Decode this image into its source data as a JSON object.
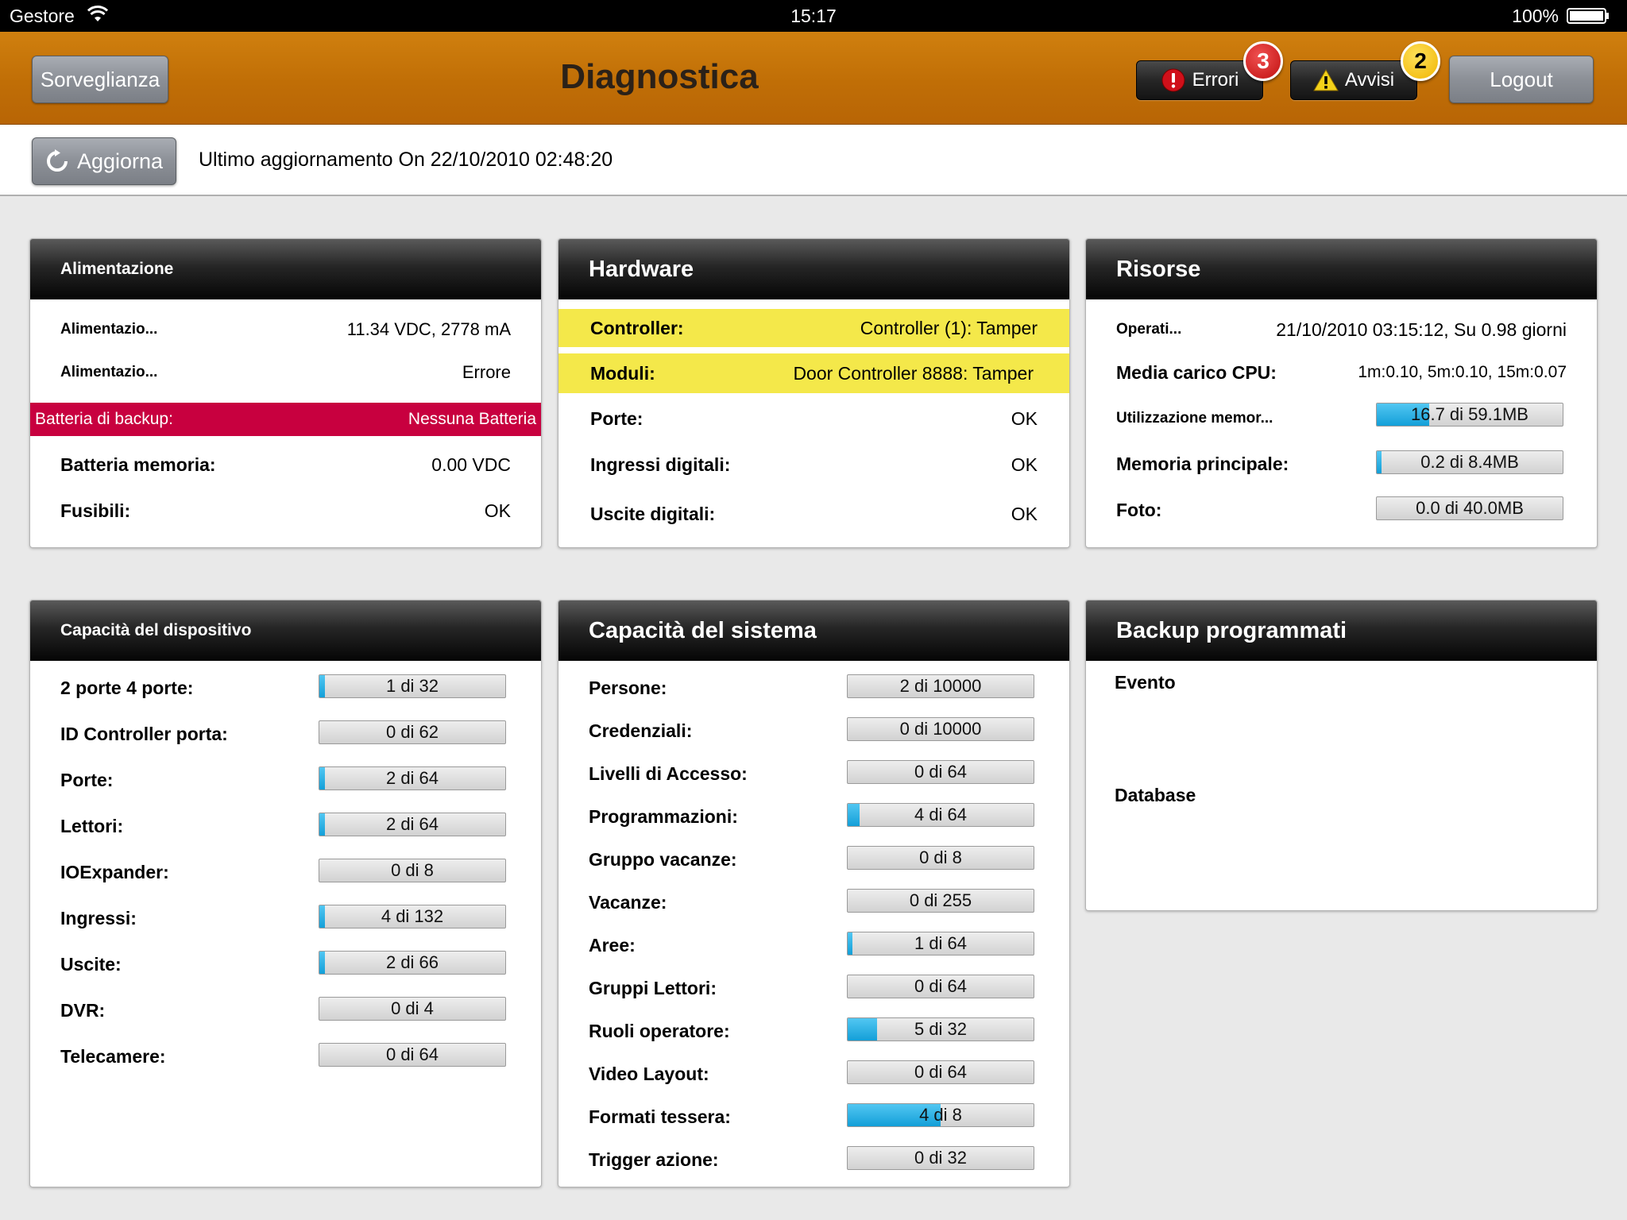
{
  "status_bar": {
    "carrier": "Gestore",
    "time": "15:17",
    "battery": "100%"
  },
  "nav": {
    "left_button": "Sorveglianza",
    "title": "Diagnostica",
    "errors": {
      "label": "Errori",
      "count": "3"
    },
    "warnings": {
      "label": "Avvisi",
      "count": "2"
    },
    "logout": "Logout"
  },
  "refresh": {
    "button": "Aggiorna",
    "last_update": "Ultimo aggiornamento On 22/10/2010 02:48:20"
  },
  "colors": {
    "nav_orange": "#c06e06",
    "error_red": "#c8003f",
    "warning_yellow": "#f4e84a",
    "progress_blue": "#1aa4dc"
  },
  "power": {
    "title": "Alimentazione",
    "rows": [
      {
        "label": "Alimentazio...",
        "value": "11.34 VDC, 2778 mA"
      },
      {
        "label": "Alimentazio...",
        "value": "Errore"
      },
      {
        "label": "Batteria di backup:",
        "value": "Nessuna Batteria"
      },
      {
        "label": "Batteria memoria:",
        "value": "0.00 VDC"
      },
      {
        "label": "Fusibili:",
        "value": "OK"
      }
    ]
  },
  "hardware": {
    "title": "Hardware",
    "rows": [
      {
        "label": "Controller:",
        "value": "Controller (1): Tamper"
      },
      {
        "label": "Moduli:",
        "value": "Door Controller 8888: Tamper"
      },
      {
        "label": "Porte:",
        "value": "OK"
      },
      {
        "label": "Ingressi digitali:",
        "value": "OK"
      },
      {
        "label": "Uscite digitali:",
        "value": "OK"
      }
    ]
  },
  "resources": {
    "title": "Risorse",
    "rows": [
      {
        "label": "Operati...",
        "value": "21/10/2010 03:15:12, Su 0.98 giorni"
      },
      {
        "label": "Media carico CPU:",
        "value": "1m:0.10, 5m:0.10, 15m:0.07"
      },
      {
        "label": "Utilizzazione memor...",
        "value": "16.7 di 59.1MB",
        "fill": 0.283
      },
      {
        "label": "Memoria principale:",
        "value": "0.2 di 8.4MB",
        "fill": 0.024
      },
      {
        "label": "Foto:",
        "value": "0.0 di 40.0MB",
        "fill": 0
      }
    ]
  },
  "device_capacity": {
    "title": "Capacità del dispositivo",
    "rows": [
      {
        "label": "2 porte 4 porte:",
        "value": "1 di 32",
        "fill": 0.031
      },
      {
        "label": "ID Controller porta:",
        "value": "0 di 62",
        "fill": 0
      },
      {
        "label": "Porte:",
        "value": "2 di 64",
        "fill": 0.031
      },
      {
        "label": "Lettori:",
        "value": "2 di 64",
        "fill": 0.031
      },
      {
        "label": "IOExpander:",
        "value": "0 di 8",
        "fill": 0
      },
      {
        "label": "Ingressi:",
        "value": "4 di 132",
        "fill": 0.03
      },
      {
        "label": "Uscite:",
        "value": "2 di 66",
        "fill": 0.03
      },
      {
        "label": "DVR:",
        "value": "0 di 4",
        "fill": 0
      },
      {
        "label": "Telecamere:",
        "value": "0 di 64",
        "fill": 0
      }
    ]
  },
  "system_capacity": {
    "title": "Capacità del sistema",
    "rows": [
      {
        "label": "Persone:",
        "value": "2 di 10000",
        "fill": 0
      },
      {
        "label": "Credenziali:",
        "value": "0 di 10000",
        "fill": 0
      },
      {
        "label": "Livelli di Accesso:",
        "value": "0 di 64",
        "fill": 0
      },
      {
        "label": "Programmazioni:",
        "value": "4 di 64",
        "fill": 0.0625
      },
      {
        "label": "Gruppo vacanze:",
        "value": "0 di 8",
        "fill": 0
      },
      {
        "label": "Vacanze:",
        "value": "0 di 255",
        "fill": 0
      },
      {
        "label": "Aree:",
        "value": "1 di 64",
        "fill": 0.0156
      },
      {
        "label": "Gruppi Lettori:",
        "value": "0 di 64",
        "fill": 0
      },
      {
        "label": "Ruoli operatore:",
        "value": "5 di 32",
        "fill": 0.156
      },
      {
        "label": "Video Layout:",
        "value": "0 di 64",
        "fill": 0
      },
      {
        "label": "Formati tessera:",
        "value": "4 di 8",
        "fill": 0.5
      },
      {
        "label": "Trigger azione:",
        "value": "0 di 32",
        "fill": 0
      }
    ]
  },
  "scheduled_backups": {
    "title": "Backup programmati",
    "event_label": "Evento",
    "database_label": "Database"
  }
}
